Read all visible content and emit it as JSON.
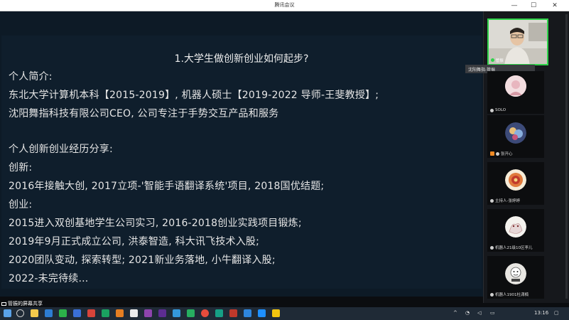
{
  "window": {
    "title": "腾讯会议"
  },
  "slide": {
    "title": "1.大学生做创新创业如何起步?",
    "lines": [
      "个人简介:",
      "东北大学计算机本科【2015-2019】, 机器人硕士【2019-2022 导师-王斐教授】;",
      "沈阳舞指科技有限公司CEO, 公司专注于手势交互产品和服务",
      "个人创新创业经历分享:",
      "创新:",
      "2016年接触大创, 2017立项-'智能手语翻译系统'项目, 2018国优结题;",
      "创业:",
      "2015进入双创基地学生公司实习, 2016-2018创业实践项目锻炼;",
      "2019年9月正式成立公司, 洪泰智造, 科大讯飞技术入股;",
      "2020团队变动, 探索转型; 2021新业务落地, 小牛翻译入股;",
      "2022-未完待续..."
    ]
  },
  "share": {
    "label": "管振的屏幕共享"
  },
  "participants": {
    "tooltip": "沈阳舞指-管振",
    "items": [
      {
        "name": "管振"
      },
      {
        "name": "SOLO"
      },
      {
        "name": "张开心"
      },
      {
        "name": "主持人-张婷婷"
      },
      {
        "name": "机器人21级10区李儿"
      },
      {
        "name": "机器人1901杜潇楠"
      }
    ]
  },
  "taskbar": {
    "time": "13:16"
  },
  "colors": {
    "active_speaker": "#2fd34a",
    "slide_bg": "#0f1e2c"
  }
}
